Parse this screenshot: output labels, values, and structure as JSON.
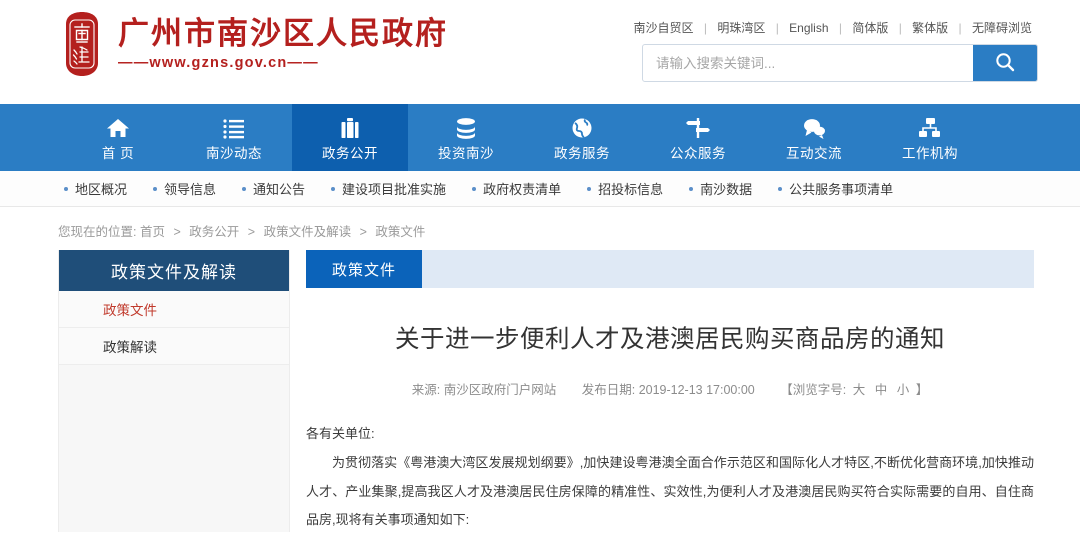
{
  "site": {
    "logo_title": "广州市南沙区人民政府",
    "logo_sub": "——www.gzns.gov.cn——",
    "seal_icon": "red-seal-emblem"
  },
  "toplinks": [
    {
      "label": "南沙自贸区"
    },
    {
      "label": "明珠湾区"
    },
    {
      "label": "English"
    },
    {
      "label": "简体版"
    },
    {
      "label": "繁体版"
    },
    {
      "label": "无障碍浏览"
    }
  ],
  "search": {
    "placeholder": "请输入搜索关键词...",
    "value": "",
    "button_icon": "search-icon"
  },
  "mainnav": [
    {
      "label": "首 页",
      "icon": "home-icon",
      "active": false
    },
    {
      "label": "南沙动态",
      "icon": "list-icon",
      "active": false
    },
    {
      "label": "政务公开",
      "icon": "briefcase-icon",
      "active": true
    },
    {
      "label": "投资南沙",
      "icon": "database-icon",
      "active": false
    },
    {
      "label": "政务服务",
      "icon": "globe-icon",
      "active": false
    },
    {
      "label": "公众服务",
      "icon": "signpost-icon",
      "active": false
    },
    {
      "label": "互动交流",
      "icon": "chat-icon",
      "active": false
    },
    {
      "label": "工作机构",
      "icon": "org-chart-icon",
      "active": false
    }
  ],
  "subnav": [
    {
      "label": "地区概况"
    },
    {
      "label": "领导信息"
    },
    {
      "label": "通知公告"
    },
    {
      "label": "建设项目批准实施"
    },
    {
      "label": "政府权责清单"
    },
    {
      "label": "招投标信息"
    },
    {
      "label": "南沙数据"
    },
    {
      "label": "公共服务事项清单"
    }
  ],
  "breadcrumb": {
    "prefix": "您现在的位置:",
    "items": [
      {
        "label": "首页"
      },
      {
        "label": "政务公开"
      },
      {
        "label": "政策文件及解读"
      },
      {
        "label": "政策文件"
      }
    ],
    "separator": ">"
  },
  "sidebar": {
    "title": "政策文件及解读",
    "items": [
      {
        "label": "政策文件",
        "active": true
      },
      {
        "label": "政策解读",
        "active": false
      }
    ]
  },
  "content": {
    "tab": "政策文件",
    "title": "关于进一步便利人才及港澳居民购买商品房的通知",
    "meta": {
      "source_label": "来源:",
      "source_value": "南沙区政府门户网站",
      "date_label": "发布日期:",
      "date_value": "2019-12-13 17:00:00",
      "fontsize_prefix": "【浏览字号:",
      "fontsize_large": "大",
      "fontsize_medium": "中",
      "fontsize_small": "小",
      "fontsize_suffix": "】"
    },
    "paragraphs": [
      "各有关单位:",
      "为贯彻落实《粤港澳大湾区发展规划纲要》,加快建设粤港澳全面合作示范区和国际化人才特区,不断优化营商环境,加快推动人才、产业集聚,提高我区人才及港澳居民住房保障的精准性、实效性,为便利人才及港澳居民购买符合实际需要的自用、自住商品房,现将有关事项通知如下:"
    ]
  },
  "colors": {
    "brand_red": "#b4201e",
    "nav_blue": "#2b7dc4",
    "nav_active_blue": "#0d5fae",
    "sidebar_head": "#1f4e79",
    "tab_blue": "#0b63ba",
    "tabbar_bg": "#dfe9f5",
    "active_item_red": "#c0392b"
  }
}
